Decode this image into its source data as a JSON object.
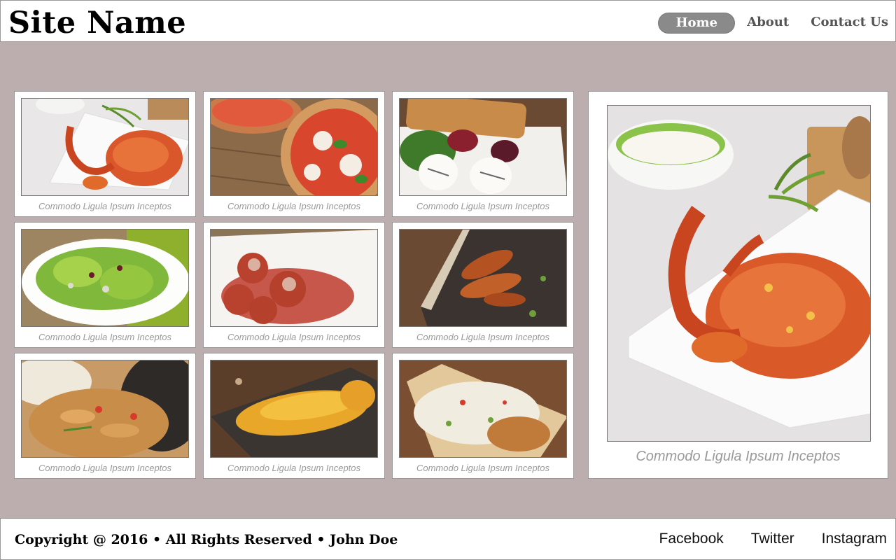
{
  "header": {
    "site_name": "Site Name",
    "nav": [
      {
        "label": "Home",
        "active": true
      },
      {
        "label": "About"
      },
      {
        "label": "Contact Us"
      }
    ]
  },
  "gallery": {
    "items": [
      {
        "caption": "Commodo Ligula Ipsum Inceptos",
        "image": "crab-dish"
      },
      {
        "caption": "Commodo Ligula Ipsum Inceptos",
        "image": "pizza"
      },
      {
        "caption": "Commodo Ligula Ipsum Inceptos",
        "image": "burrata-salad"
      },
      {
        "caption": "Commodo Ligula Ipsum Inceptos",
        "image": "green-salad"
      },
      {
        "caption": "Commodo Ligula Ipsum Inceptos",
        "image": "meatballs"
      },
      {
        "caption": "Commodo Ligula Ipsum Inceptos",
        "image": "grilled-shrimp"
      },
      {
        "caption": "Commodo Ligula Ipsum Inceptos",
        "image": "chicken-stir-fry"
      },
      {
        "caption": "Commodo Ligula Ipsum Inceptos",
        "image": "cheese-casserole"
      },
      {
        "caption": "Commodo Ligula Ipsum Inceptos",
        "image": "fried-rice"
      }
    ]
  },
  "feature": {
    "caption": "Commodo Ligula Ipsum Inceptos",
    "image": "crab-dish-large"
  },
  "footer": {
    "copyright": "Copyright @ 2016 • All Rights Reserved • John Doe",
    "social": [
      "Facebook",
      "Twitter",
      "Instagram"
    ]
  },
  "colors": {
    "background": "#bcadae",
    "active_nav": "#8a8a8a",
    "caption": "#999999"
  }
}
